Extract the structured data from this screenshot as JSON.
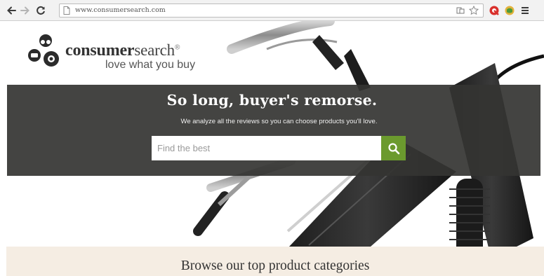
{
  "browser": {
    "url": "www.consumersearch.com"
  },
  "site": {
    "logo_name_bold": "consumer",
    "logo_name_light": "search",
    "logo_registered": "®",
    "logo_tagline": "love what you buy"
  },
  "hero": {
    "headline": "So long, buyer's remorse.",
    "subline": "We analyze all the reviews so you can choose products you'll love.",
    "search_placeholder": "Find the best",
    "search_value": ""
  },
  "browse": {
    "title": "Browse our top product categories"
  },
  "colors": {
    "band": "#343432",
    "search_button": "#6b9a2e",
    "browse_bg": "#f5ede3"
  }
}
